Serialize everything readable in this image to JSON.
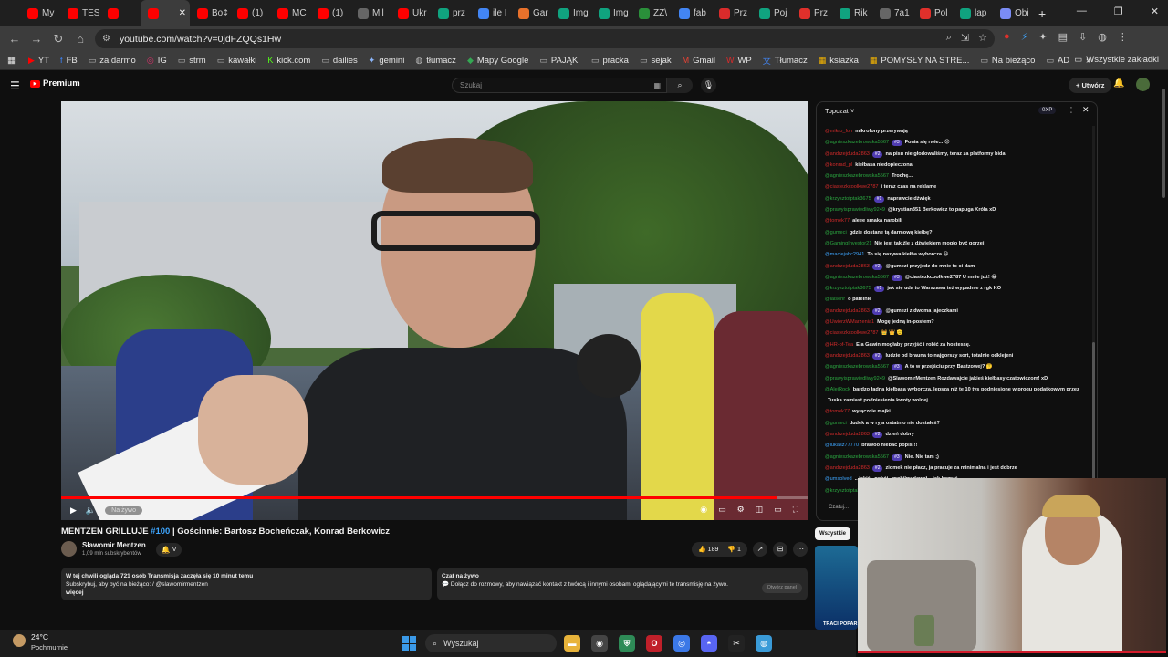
{
  "browser": {
    "tabs": [
      {
        "label": "My",
        "icon": "youtube-icon",
        "color": "#ff0000"
      },
      {
        "label": "TES",
        "icon": "youtube-icon",
        "color": "#ff0000"
      },
      {
        "label": "",
        "icon": "speaker-icon",
        "color": "#ff0000"
      },
      {
        "label": "",
        "icon": "youtube-icon",
        "color": "#ff0000",
        "active": true
      },
      {
        "label": "Bo¢",
        "icon": "youtube-icon",
        "color": "#ff0000"
      },
      {
        "label": "(1)",
        "icon": "youtube-icon",
        "color": "#ff0000"
      },
      {
        "label": "MC",
        "icon": "youtube-icon",
        "color": "#ff0000"
      },
      {
        "label": "(1)",
        "icon": "youtube-icon",
        "color": "#ff0000"
      },
      {
        "label": "Mil",
        "icon": "web-icon",
        "color": "#666666"
      },
      {
        "label": "Ukr",
        "icon": "youtube-icon",
        "color": "#ff0000"
      },
      {
        "label": "prz",
        "icon": "chatgpt-icon",
        "color": "#10a37f"
      },
      {
        "label": "ile I",
        "icon": "google-icon",
        "color": "#4285f4"
      },
      {
        "label": "Gar",
        "icon": "c-icon",
        "color": "#e8712b"
      },
      {
        "label": "Img",
        "icon": "image-icon",
        "color": "#10a37f"
      },
      {
        "label": "Img",
        "icon": "image-icon",
        "color": "#10a37f"
      },
      {
        "label": "ZZ\\",
        "icon": "zz-icon",
        "color": "#2a8f3a"
      },
      {
        "label": "fab",
        "icon": "google-icon",
        "color": "#4285f4"
      },
      {
        "label": "Prz",
        "icon": "s-icon",
        "color": "#d92b2b"
      },
      {
        "label": "Poj",
        "icon": "chatgpt-icon",
        "color": "#10a37f"
      },
      {
        "label": "Prz",
        "icon": "a-icon",
        "color": "#e0302b"
      },
      {
        "label": "Rik",
        "icon": "chatgpt-icon",
        "color": "#10a37f"
      },
      {
        "label": "7a1",
        "icon": "web-icon",
        "color": "#666666"
      },
      {
        "label": "Pol",
        "icon": "a-icon",
        "color": "#e0302b"
      },
      {
        "label": "lap",
        "icon": "chatgpt-icon",
        "color": "#10a37f"
      },
      {
        "label": "Obi",
        "icon": "gemini-icon",
        "color": "#7b8cf5"
      }
    ],
    "new_tab": "+",
    "url": "youtube.com/watch?v=0jdFZQQs1Hw",
    "bookmarks": [
      {
        "label": "YT",
        "icon": "youtube-icon"
      },
      {
        "label": "FB",
        "icon": "facebook-icon"
      },
      {
        "label": "za darmo",
        "icon": "folder-icon"
      },
      {
        "label": "IG",
        "icon": "instagram-icon"
      },
      {
        "label": "strm",
        "icon": "folder-icon"
      },
      {
        "label": "kawałki",
        "icon": "folder-icon"
      },
      {
        "label": "kick.com",
        "icon": "kick-icon"
      },
      {
        "label": "dailies",
        "icon": "folder-icon"
      },
      {
        "label": "gemini",
        "icon": "gemini-icon"
      },
      {
        "label": "tłumacz",
        "icon": "chatgpt-icon"
      },
      {
        "label": "Mapy Google",
        "icon": "maps-icon"
      },
      {
        "label": "PAJĄKI",
        "icon": "folder-icon"
      },
      {
        "label": "pracka",
        "icon": "folder-icon"
      },
      {
        "label": "sejak",
        "icon": "folder-icon"
      },
      {
        "label": "Gmail",
        "icon": "gmail-icon"
      },
      {
        "label": "WP",
        "icon": "wp-icon"
      },
      {
        "label": "Tłumacz",
        "icon": "translate-icon"
      },
      {
        "label": "ksiazka",
        "icon": "grid-icon"
      },
      {
        "label": "POMYSŁY NA STRE...",
        "icon": "grid-icon"
      },
      {
        "label": "Na bieżąco",
        "icon": "folder-icon"
      },
      {
        "label": "AD",
        "icon": "folder-icon"
      }
    ],
    "all_bookmarks": "Wszystkie zakładki"
  },
  "youtube": {
    "logo": "Premium",
    "search_placeholder": "Szukaj",
    "create": "Utwórz",
    "video": {
      "title_prefix": "MENTZEN GRILLUJE ",
      "title_tag": "#100",
      "title_rest": " | Gościnnie: Bartosz Bocheńczak, Konrad Berkowicz",
      "live_label": "Na żywo",
      "progress": 0.96
    },
    "channel": {
      "name": "Sławomir Mentzen",
      "subs": "1,09 mln subskrybentów"
    },
    "likes": "189",
    "dislikes": "1",
    "description": {
      "line1": "W tej chwili ogląda 721 osób  Transmisja zaczęła się 10 minut temu",
      "line2": "Subskrybuj, aby być na bieżąco:  / @slawomirmentzen",
      "more": "więcej"
    },
    "chat_card": {
      "title": "Czat na żywo",
      "text": "Dołącz do rozmowy, aby nawiązać kontakt z twórcą i innymi osobami oglądającymi tę transmisję na żywo.",
      "button": "Otwórz panel"
    },
    "livechat": {
      "title": "Topczat",
      "points": "0XP",
      "input_placeholder": "Czatuj...",
      "messages": [
        {
          "user": "@mikro_fon",
          "color": "#d12a2a",
          "badge": "",
          "text": "mikrofony przerywają"
        },
        {
          "user": "@agnieszkazebrowska5567",
          "color": "#2ba640",
          "badge": "#3",
          "text": "Fonia się rwie... 😟"
        },
        {
          "user": "@andrzejduda2863",
          "color": "#d12a2a",
          "badge": "#2",
          "text": "na pisu nie głodowaliśmy, teraz za platformy bida"
        },
        {
          "user": "@konrad_pl",
          "color": "#d12a2a",
          "badge": "",
          "text": "kiełbasa niedopieczona"
        },
        {
          "user": "@agnieszkazebrowska5567",
          "color": "#2ba640",
          "badge": "",
          "text": "Trochę..."
        },
        {
          "user": "@ciastezkcoolkwe2787",
          "color": "#d12a2a",
          "badge": "",
          "text": "i teraz czas na reklame"
        },
        {
          "user": "@krzysztofptak3675",
          "color": "#2ba640",
          "badge": "#1",
          "text": "naprawcie dźwięk"
        },
        {
          "user": "@prawyisprawiedliwy9249",
          "color": "#2ba640",
          "badge": "",
          "text": "@krystian351 Berkowicz to papuga Króla xD"
        },
        {
          "user": "@tomek77",
          "color": "#d12a2a",
          "badge": "",
          "text": "aleee smaka narobili"
        },
        {
          "user": "@gumeci",
          "color": "#2ba640",
          "badge": "",
          "text": "gdzie dostane tą darmową kiełbę?"
        },
        {
          "user": "@GamingInvestor21",
          "color": "#2ba640",
          "badge": "",
          "text": "Nie jest tak źle z dźwiękiem mogło być gorzej"
        },
        {
          "user": "@maciejabc2941",
          "color": "#3ea6ff",
          "badge": "",
          "text": "To się nazywa kiełba wyborcza 😆"
        },
        {
          "user": "@andrzejduda2863",
          "color": "#d12a2a",
          "badge": "#2",
          "text": "@gumezi przyjedz do mnie to ci dam"
        },
        {
          "user": "@agnieszkazebrowska5567",
          "color": "#2ba640",
          "badge": "#3",
          "text": "@ciastezkcoolkwe2787 U mnie już! 😂"
        },
        {
          "user": "@krzysztofptak3675",
          "color": "#2ba640",
          "badge": "#1",
          "text": "jak się uda to Warszawa też wypadnie z rgk KO"
        },
        {
          "user": "@laisenr",
          "color": "#2ba640",
          "badge": "",
          "text": "o patelnie"
        },
        {
          "user": "@andrzejduda2863",
          "color": "#d12a2a",
          "badge": "#2",
          "text": "@gumezi z dwoma jajeczkami"
        },
        {
          "user": "@UwierzWMarzenia1",
          "color": "#d12a2a",
          "badge": "",
          "text": "Mogę jedną in-postem?"
        },
        {
          "user": "@ciastezkcoolkwe2787",
          "color": "#d12a2a",
          "badge": "",
          "text": "👑 👑 🫡"
        },
        {
          "user": "@HR-of-Tea",
          "color": "#d12a2a",
          "badge": "",
          "text": "Ela Gawin mogłaby przyjść i robić za hostessę."
        },
        {
          "user": "@andrzejduda2863",
          "color": "#d12a2a",
          "badge": "#2",
          "text": "ludzie od brauna to najgorszy sort, totalnie odklejeni"
        },
        {
          "user": "@agnieszkazebrowska5567",
          "color": "#2ba640",
          "badge": "#3",
          "text": "A to w przejściu przy Bastzowej? 🤔"
        },
        {
          "user": "@prawyisprawiedliwy9249",
          "color": "#2ba640",
          "badge": "",
          "text": "@SlawomirMentzen Rozdawajcie jakieś kiełbasy czatowiczom! xD"
        },
        {
          "user": "@AlejRock",
          "color": "#2ba640",
          "badge": "",
          "text": "bardzo ładna kiełbasa wyborcza. lepsza niż te 10 tys podniesione w progu podatkowym przez"
        },
        {
          "user": "",
          "color": "#f1f1f1",
          "badge": "",
          "text": "Tuska zamiast podniesienia kwoty wolnej"
        },
        {
          "user": "@tomek77",
          "color": "#d12a2a",
          "badge": "",
          "text": "wyłączcie majki"
        },
        {
          "user": "@gumeci",
          "color": "#2ba640",
          "badge": "",
          "text": "dudek a w ryja ostatnio nie dostałeś?"
        },
        {
          "user": "@andrzejduda2863",
          "color": "#d12a2a",
          "badge": "#2",
          "text": "dzień dobry"
        },
        {
          "user": "@lukasz77770",
          "color": "#3ea6ff",
          "badge": "",
          "text": "brawoo niebac popis!!!"
        },
        {
          "user": "@agnieszkazebrowska5567",
          "color": "#2ba640",
          "badge": "#3",
          "text": "Nie. Nie tam ;)"
        },
        {
          "user": "@andrzejduda2863",
          "color": "#d12a2a",
          "badge": "#2",
          "text": "ziomek nie płacz, ja pracuje za minimalna i jest dobrze"
        },
        {
          "user": "@umsolved",
          "color": "#3ea6ff",
          "badge": "",
          "text": "...jakiś...pokój...mobilny.dawał ...jak.komuś"
        },
        {
          "user": "@krzysztofptak3675",
          "color": "#2ba640",
          "badge": "",
          "text": ""
        }
      ]
    },
    "filter_all": "Wszystkie",
    "short_caption": "TRACI POPAR"
  },
  "taskbar": {
    "temp": "24°C",
    "condition": "Pochmurnie",
    "search": "Wyszukaj"
  }
}
